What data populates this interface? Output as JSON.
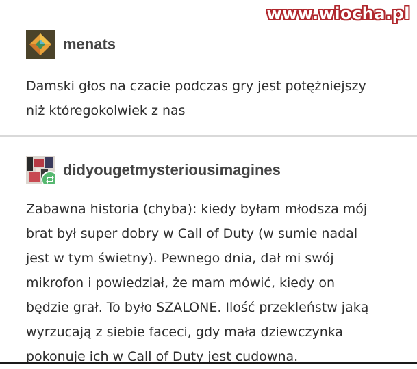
{
  "watermark": "www.wiocha.pl",
  "posts": [
    {
      "username": "menats",
      "avatar_icon": "diamond-avatar-icon",
      "lines": [
        "Damski głos na czacie podczas gry jest potężniejszy",
        "niż któregokolwiek z nas"
      ]
    },
    {
      "username": "didyougetmysteriousimagines",
      "avatar_icon": "collage-avatar-icon",
      "reblog_icon": "reblog-icon",
      "lines": [
        "Zabawna historia (chyba): kiedy byłam młodsza mój",
        "brat był super dobry w Call of Duty (w sumie nadal",
        "jest w tym świetny). Pewnego dnia, dał mi swój",
        "mikrofon i powiedział, że mam mówić, kiedy on",
        "będzie grał. To było SZALONE. Ilość przekleństw jaką",
        "wyrzucają z siebie faceci, gdy mała dziewczynka",
        "pokonuje ich w Call of Duty jest cudowna."
      ]
    }
  ],
  "colors": {
    "watermark_outline": "#b0272d",
    "reblog_badge": "#56b870",
    "avatar1_bg": "#5a4f2f"
  }
}
